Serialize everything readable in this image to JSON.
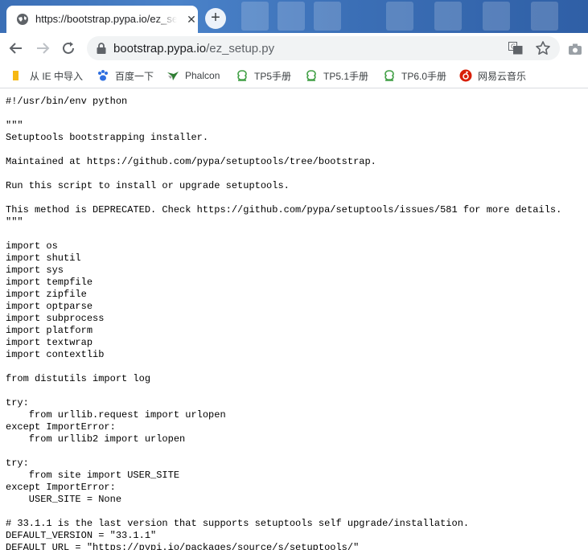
{
  "tab": {
    "title": "https://bootstrap.pypa.io/ez_setup.py",
    "close_icon": "close-icon",
    "new_tab_icon": "plus-icon"
  },
  "toolbar": {
    "url_host": "bootstrap.pypa.io",
    "url_path": "/ez_setup.py"
  },
  "bookmarks": [
    {
      "label": "从 IE 中导入",
      "icon": "folder-icon",
      "color": "#f9c23c"
    },
    {
      "label": "百度一下",
      "icon": "paw-icon",
      "color": "#2f6fe0"
    },
    {
      "label": "Phalcon",
      "icon": "bird-icon",
      "color": "#2e7d32"
    },
    {
      "label": "TP5手册",
      "icon": "tp-icon",
      "color": "#43a047"
    },
    {
      "label": "TP5.1手册",
      "icon": "tp-icon",
      "color": "#43a047"
    },
    {
      "label": "TP6.0手册",
      "icon": "tp-icon",
      "color": "#43a047"
    },
    {
      "label": "网易云音乐",
      "icon": "netease-music-icon",
      "color": "#d81e06"
    }
  ],
  "code_lines": [
    "#!/usr/bin/env python",
    "",
    "\"\"\"",
    "Setuptools bootstrapping installer.",
    "",
    "Maintained at https://github.com/pypa/setuptools/tree/bootstrap.",
    "",
    "Run this script to install or upgrade setuptools.",
    "",
    "This method is DEPRECATED. Check https://github.com/pypa/setuptools/issues/581 for more details.",
    "\"\"\"",
    "",
    "import os",
    "import shutil",
    "import sys",
    "import tempfile",
    "import zipfile",
    "import optparse",
    "import subprocess",
    "import platform",
    "import textwrap",
    "import contextlib",
    "",
    "from distutils import log",
    "",
    "try:",
    "    from urllib.request import urlopen",
    "except ImportError:",
    "    from urllib2 import urlopen",
    "",
    "try:",
    "    from site import USER_SITE",
    "except ImportError:",
    "    USER_SITE = None",
    "",
    "# 33.1.1 is the last version that supports setuptools self upgrade/installation.",
    "DEFAULT_VERSION = \"33.1.1\"",
    "DEFAULT_URL = \"https://pypi.io/packages/source/s/setuptools/\""
  ]
}
